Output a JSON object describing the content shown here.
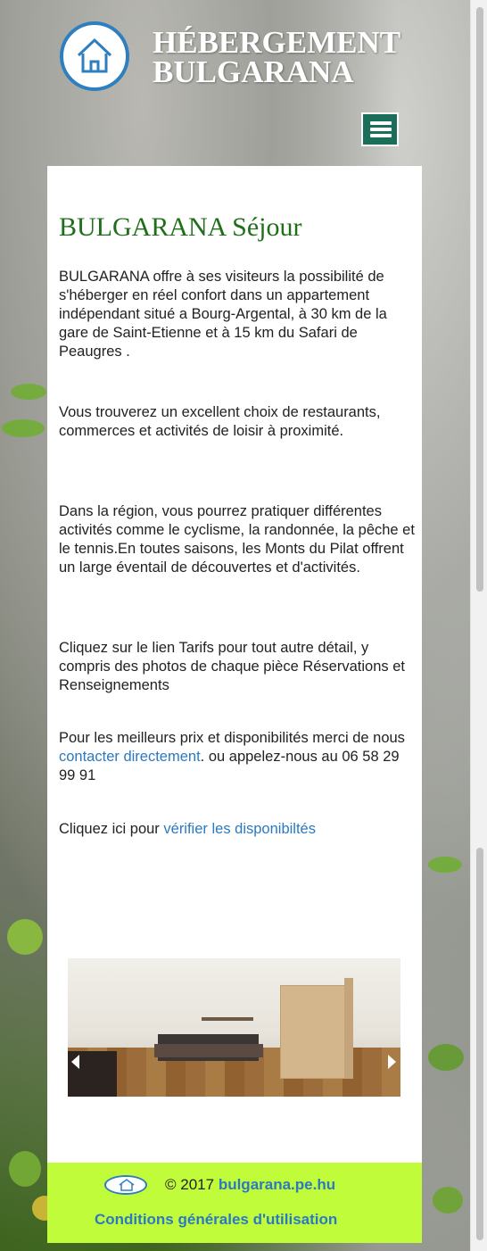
{
  "header": {
    "title_line1": "HÉBERGEMENT",
    "title_line2": "BULGARANA",
    "logo_icon": "house-icon",
    "menu_icon": "hamburger-menu-icon"
  },
  "content": {
    "heading": "BULGARANA Séjour",
    "paragraphs": [
      "BULGARANA offre à ses visiteurs la possibilité de s'héberger en réel confort dans un appartement indépendant situé a Bourg-Argental, à 30 km de la gare de Saint-Etienne et à 15 km du Safari de Peaugres .",
      "Vous trouverez un excellent choix de restaurants, commerces et activités de loisir à proximité.",
      "Dans la région, vous pourrez pratiquer différentes activités comme le cyclisme, la randonnée, la pêche et le tennis.En toutes saisons, les Monts du Pilat offrent un large éventail de découvertes et d'activités.",
      "Cliquez sur le lien Tarifs pour tout autre détail, y compris des photos de chaque pièce Réservations et Renseignements"
    ],
    "contact": {
      "before": "Pour les meilleurs prix et disponibilités merci de nous ",
      "link": "contacter directement",
      "after": ". ou appelez-nous au  06 58 29 99 91"
    },
    "availability": {
      "before": "Cliquez ici pour ",
      "link": "vérifier les disponibiltés"
    }
  },
  "slider": {
    "image_icon": "bedroom-photo",
    "prev_icon": "arrow-left-icon",
    "next_icon": "arrow-right-icon"
  },
  "footer": {
    "copyright": "© 2017",
    "site": "bulgarana.pe.hu",
    "terms": "Conditions générales d'utilisation"
  },
  "colors": {
    "heading": "#1e6e1a",
    "link": "#2b79c2",
    "menu_button": "#1b6f5a",
    "footer_bg": "#c1fc3a"
  }
}
